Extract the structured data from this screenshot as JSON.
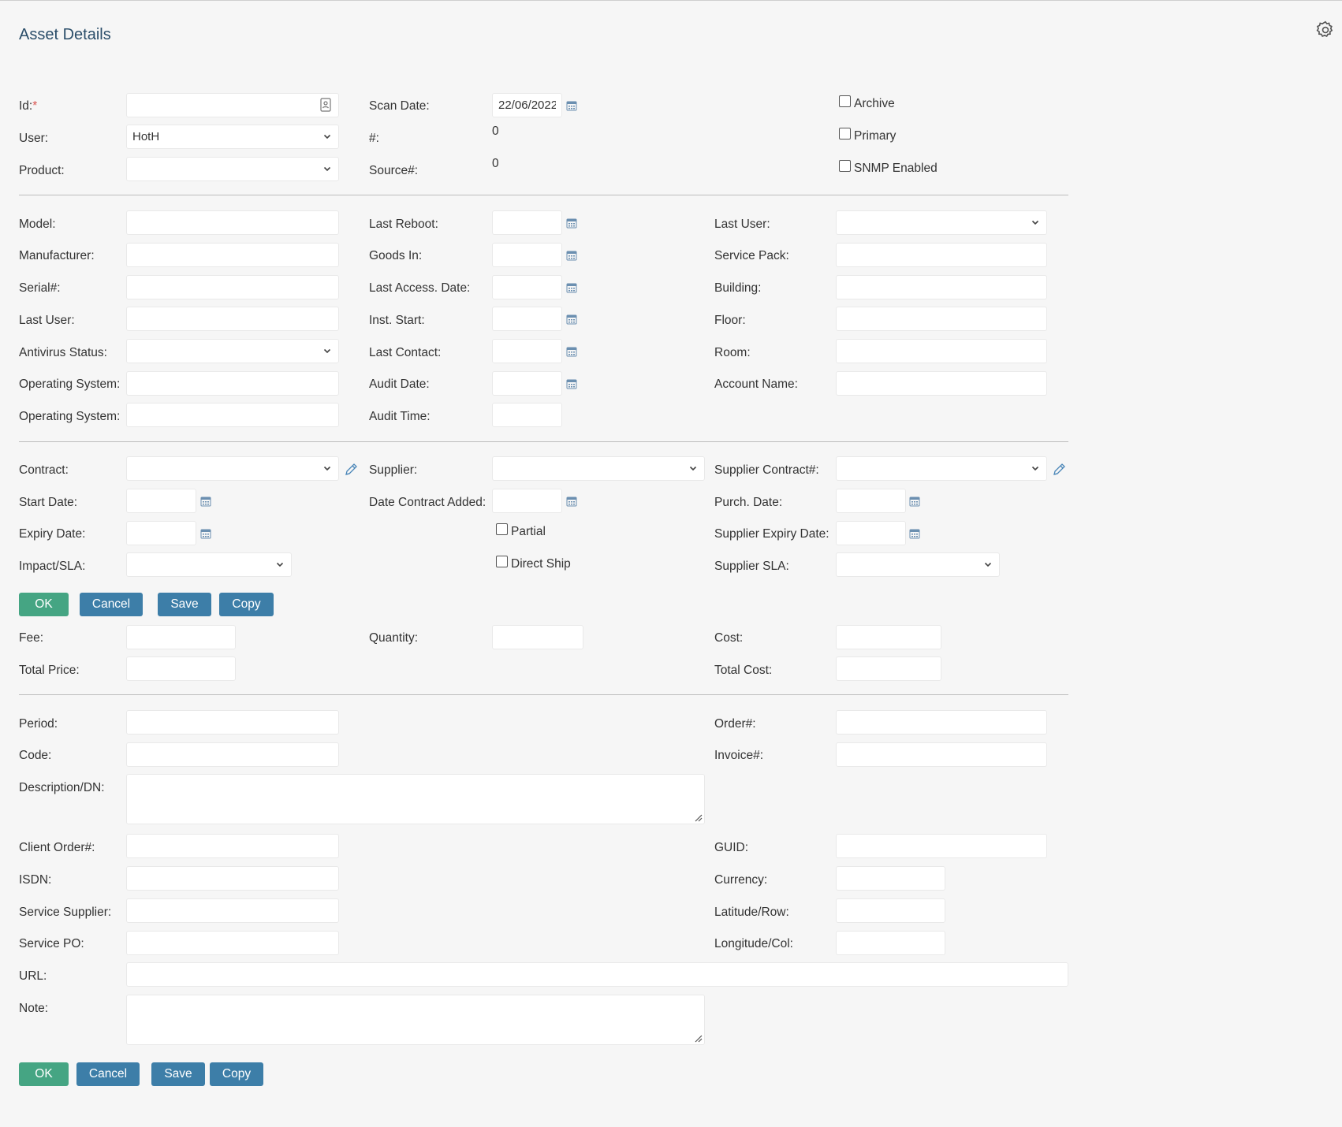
{
  "page": {
    "title": "Asset Details"
  },
  "top": {
    "id_label": "Id:",
    "id_required": "*",
    "id_value": "",
    "user_label": "User:",
    "user_value": "HotH",
    "product_label": "Product:",
    "product_value": "",
    "scan_date_label": "Scan Date:",
    "scan_date_value": "22/06/2022",
    "hash_label": "#:",
    "hash_value": "0",
    "source_label": "Source#:",
    "source_value": "0",
    "archive_label": "Archive",
    "primary_label": "Primary",
    "snmp_label": "SNMP Enabled"
  },
  "details": {
    "model_label": "Model:",
    "manufacturer_label": "Manufacturer:",
    "serial_label": "Serial#:",
    "last_user_label": "Last User:",
    "antivirus_label": "Antivirus Status:",
    "os1_label": "Operating System:",
    "os2_label": "Operating System:",
    "last_reboot_label": "Last Reboot:",
    "goods_in_label": "Goods In:",
    "last_access_label": "Last Access. Date:",
    "inst_start_label": "Inst. Start:",
    "last_contact_label": "Last Contact:",
    "audit_date_label": "Audit Date:",
    "audit_time_label": "Audit Time:",
    "last_user_r_label": "Last User:",
    "service_pack_label": "Service Pack:",
    "building_label": "Building:",
    "floor_label": "Floor:",
    "room_label": "Room:",
    "account_name_label": "Account Name:"
  },
  "contract": {
    "contract_label": "Contract:",
    "start_date_label": "Start Date:",
    "expiry_date_label": "Expiry Date:",
    "impact_label": "Impact/SLA:",
    "supplier_label": "Supplier:",
    "date_added_label": "Date Contract Added:",
    "partial_label": "Partial",
    "direct_ship_label": "Direct Ship",
    "supplier_contract_label": "Supplier Contract#:",
    "purch_date_label": "Purch. Date:",
    "supplier_expiry_label": "Supplier Expiry Date:",
    "supplier_sla_label": "Supplier SLA:"
  },
  "buttons": {
    "ok": "OK",
    "cancel": "Cancel",
    "save": "Save",
    "copy": "Copy"
  },
  "pricing": {
    "fee_label": "Fee:",
    "total_price_label": "Total Price:",
    "quantity_label": "Quantity:",
    "cost_label": "Cost:",
    "total_cost_label": "Total Cost:"
  },
  "misc": {
    "period_label": "Period:",
    "code_label": "Code:",
    "description_label": "Description/DN:",
    "client_order_label": "Client Order#:",
    "isdn_label": "ISDN:",
    "service_supplier_label": "Service Supplier:",
    "service_po_label": "Service PO:",
    "url_label": "URL:",
    "note_label": "Note:",
    "order_label": "Order#:",
    "invoice_label": "Invoice#:",
    "guid_label": "GUID:",
    "currency_label": "Currency:",
    "latitude_label": "Latitude/Row:",
    "longitude_label": "Longitude/Col:"
  },
  "icons": {
    "calendar": "calendar-icon",
    "edit": "pencil-icon",
    "settings": "gear-icon",
    "id_lookup": "id-card-icon",
    "dropdown": "chevron-down-icon"
  },
  "colors": {
    "ok_button": "#45a583",
    "action_button": "#3d7ea8",
    "title": "#2a4d69",
    "required": "#d9534f"
  }
}
